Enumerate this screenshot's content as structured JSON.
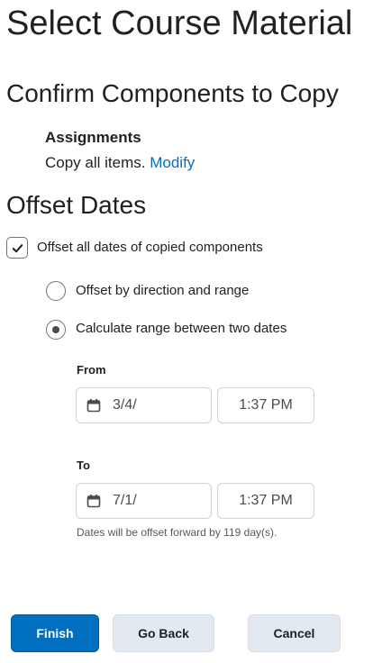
{
  "page": {
    "title": "Select Course Material"
  },
  "confirm": {
    "heading": "Confirm Components to Copy",
    "component_name": "Assignments",
    "component_desc": "Copy all items.",
    "modify_link": "Modify"
  },
  "offset": {
    "heading": "Offset Dates",
    "checkbox_label": "Offset all dates of copied components",
    "checkbox_checked": true,
    "radio_direction_label": "Offset by direction and range",
    "radio_calculate_label": "Calculate range between two dates",
    "selected_option": "calculate",
    "from_label": "From",
    "from_date": "3/4/",
    "from_time": "1:37 PM",
    "to_label": "To",
    "to_date": "7/1/",
    "to_time": "1:37 PM",
    "note": "Dates will be offset forward by 119 day(s)."
  },
  "buttons": {
    "finish": "Finish",
    "go_back": "Go Back",
    "cancel": "Cancel"
  },
  "icons": {
    "calendar": "calendar-icon",
    "checkmark": "checkmark-icon"
  },
  "colors": {
    "primary": "#006fbf",
    "secondary_button": "#e3e9f1",
    "text": "#202122"
  }
}
